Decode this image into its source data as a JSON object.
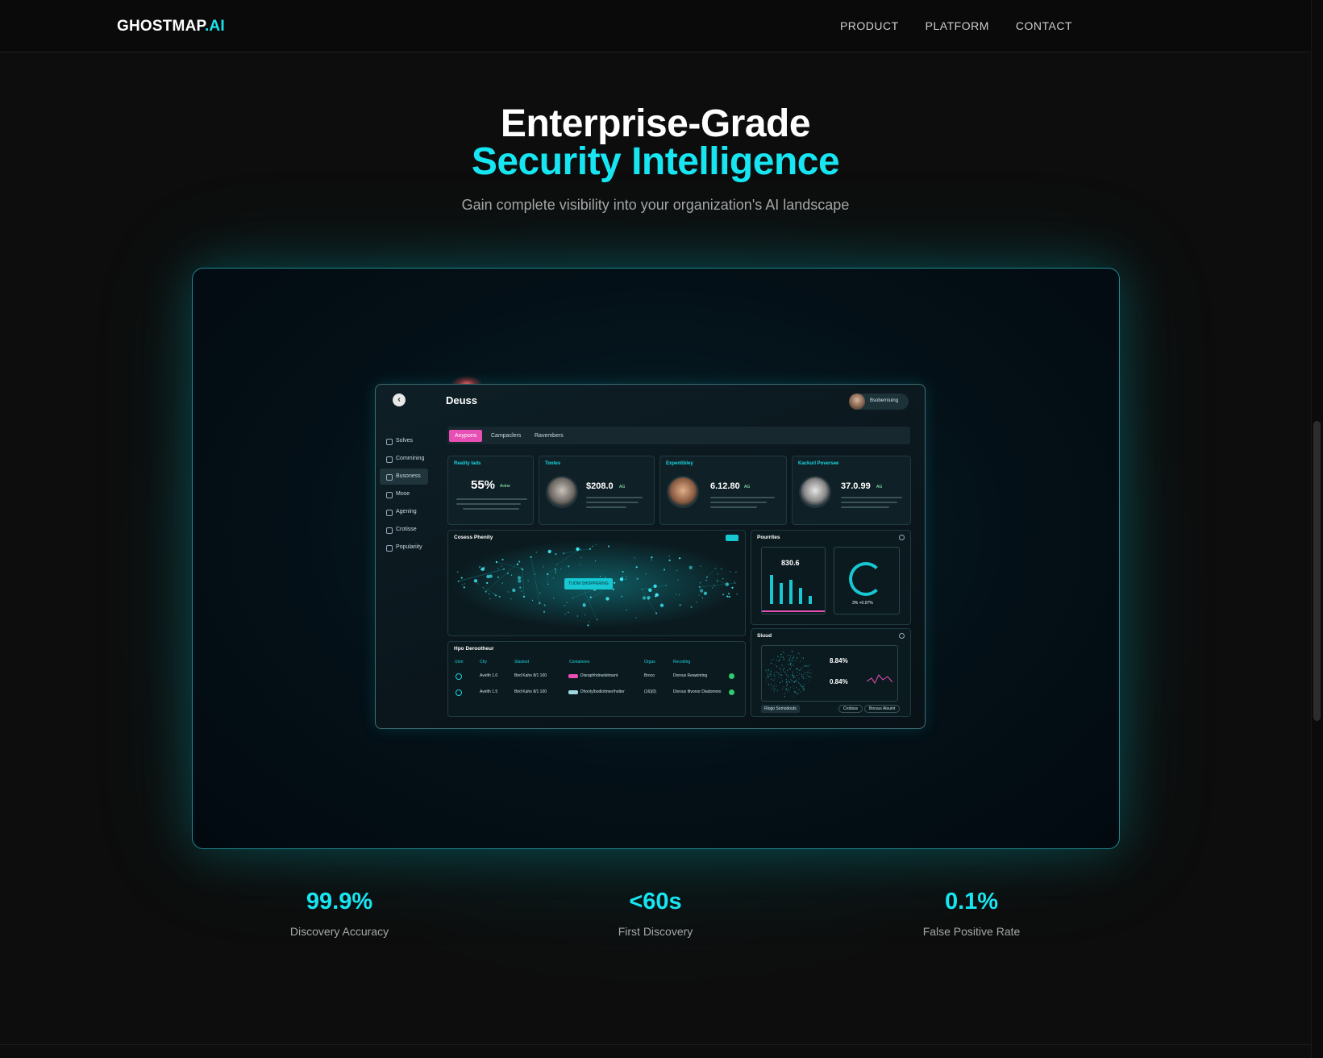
{
  "nav": {
    "logo_main": "GHOSTMAP",
    "logo_suffix": ".AI",
    "links": [
      "PRODUCT",
      "PLATFORM",
      "CONTACT"
    ]
  },
  "hero": {
    "title_line1": "Enterprise-Grade",
    "title_line2": "Security Intelligence",
    "subtitle": "Gain complete visibility into your organization's AI landscape"
  },
  "dashboard": {
    "title": "Deuss",
    "user_name": "Bsoberniuing",
    "sidebar": [
      "Solves",
      "Commining",
      "Busoness",
      "Mose",
      "Agening",
      "Crotisse",
      "Populariity"
    ],
    "tabs": [
      "Anypons",
      "Campaclers",
      "Ravembers"
    ],
    "cards": [
      {
        "title": "Reality Iads",
        "value": "55%",
        "unit": "Actne"
      },
      {
        "title": "Tootes",
        "value": "$208.0",
        "unit": "AG"
      },
      {
        "title": "Expentibley",
        "value": "6.12.80",
        "unit": "AG"
      },
      {
        "title": "Kackurl Poversee",
        "value": "37.0.99",
        "unit": "AG"
      }
    ],
    "network": {
      "title": "Cosess Phenity",
      "button": "TUOM SHOPPERING"
    },
    "previews": {
      "title": "Pourrites",
      "value": "830.6",
      "ring_label": "3% +0.07%"
    },
    "table": {
      "title": "Hpo Derootheur",
      "headers": [
        "Uom",
        "Chy",
        "Stacked",
        "Containees",
        "Orgas",
        "Recoding"
      ],
      "rows": [
        [
          "Avelth 1.0",
          "Bird Kaho 8/1 100",
          "Disraphhdrwdstrnant",
          "Broco",
          "Dorous Reawinting"
        ],
        [
          "Avelth 1.5",
          "Bird Kaho 8/1 100",
          "Dhonly/bodlottmer/hotter",
          "(16)(0)",
          "Dorous Itlvonor Diadommo"
        ]
      ]
    },
    "signal": {
      "title": "Siuud",
      "v1": "8.84%",
      "v2": "0.84%",
      "tag": "Rlogo Somodouts",
      "btn1": "Crotisss",
      "btn2": "Boruus Atsuint"
    }
  },
  "stats": [
    {
      "value": "99.9%",
      "label": "Discovery Accuracy"
    },
    {
      "value": "<60s",
      "label": "First Discovery"
    },
    {
      "value": "0.1%",
      "label": "False Positive Rate"
    }
  ],
  "colors": {
    "accent": "#17e6f2",
    "pink": "#e84fb5",
    "background": "#0d0d0d"
  }
}
